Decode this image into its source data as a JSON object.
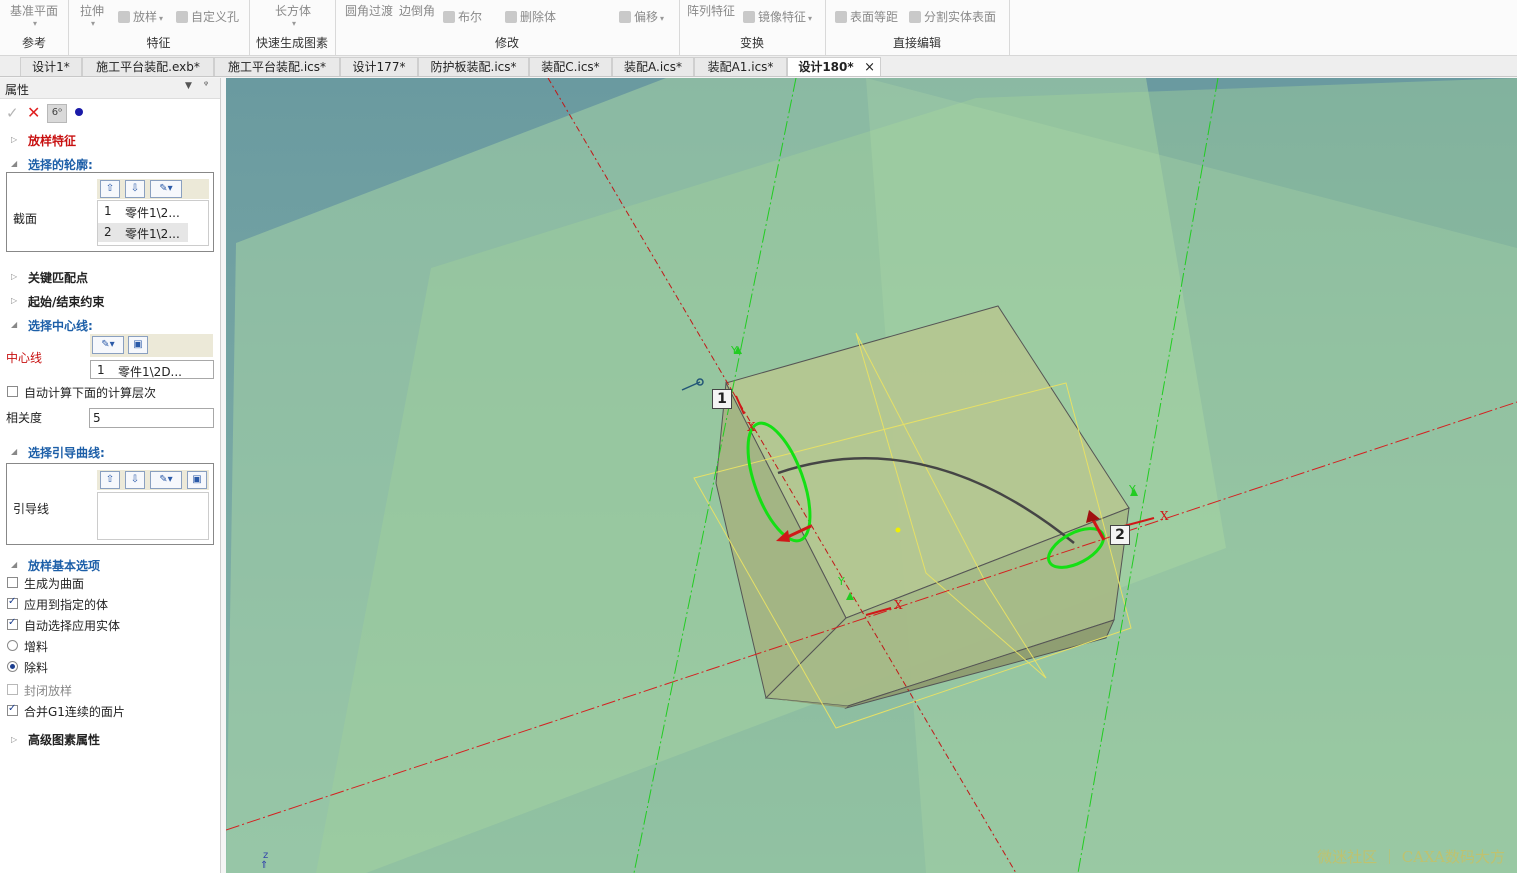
{
  "ribbon": {
    "groups": [
      {
        "label": "参考",
        "items": [
          "基准平面"
        ]
      },
      {
        "label": "特征",
        "items": [
          "拉伸",
          "放样",
          "自定义孔"
        ]
      },
      {
        "label": "快速生成图素",
        "items": [
          "长方体"
        ]
      },
      {
        "label": "修改",
        "items": [
          "圆角过渡",
          "边倒角",
          "布尔",
          "删除体",
          "偏移"
        ]
      },
      {
        "label": "变换",
        "items": [
          "阵列特征",
          "镜像特征"
        ]
      },
      {
        "label": "直接编辑",
        "items": [
          "表面等距",
          "分割实体表面"
        ]
      }
    ]
  },
  "tabs": [
    {
      "label": "设计1*"
    },
    {
      "label": "施工平台装配.exb*"
    },
    {
      "label": "施工平台装配.ics*"
    },
    {
      "label": "设计177*"
    },
    {
      "label": "防护板装配.ics*"
    },
    {
      "label": "装配C.ics*"
    },
    {
      "label": "装配A.ics*"
    },
    {
      "label": "装配A1.ics*"
    },
    {
      "label": "设计180*",
      "close": "×"
    }
  ],
  "panel": {
    "title": "属性",
    "loft_feature": "放样特征",
    "selected_profiles": {
      "heading": "选择的轮廓:",
      "label": "截面",
      "rows": [
        {
          "index": "1",
          "value": "零件1\\2..."
        },
        {
          "index": "2",
          "value": "零件1\\2..."
        }
      ]
    },
    "key_match_points": "关键匹配点",
    "start_end_constraints": "起始/结束约束",
    "centerline": {
      "heading": "选择中心线:",
      "label": "中心线",
      "row": {
        "index": "1",
        "value": "零件1\\2D..."
      }
    },
    "auto_compute": {
      "label": "自动计算下面的计算层次",
      "checked": false
    },
    "correlation": {
      "label": "相关度",
      "value": "5"
    },
    "guide_curves": {
      "heading": "选择引导曲线:",
      "label": "引导线"
    },
    "basic_options": {
      "heading": "放样基本选项",
      "options": [
        {
          "type": "checkbox",
          "label": "生成为曲面",
          "checked": false
        },
        {
          "type": "checkbox",
          "label": "应用到指定的体",
          "checked": true
        },
        {
          "type": "checkbox",
          "label": "自动选择应用实体",
          "checked": true
        },
        {
          "type": "radio",
          "label": "增料",
          "checked": false
        },
        {
          "type": "radio",
          "label": "除料",
          "checked": true
        },
        {
          "type": "checkbox",
          "label": "封闭放样",
          "checked": false
        },
        {
          "type": "checkbox",
          "label": "合并G1连续的面片",
          "checked": true
        }
      ]
    },
    "advanced": "高级图素属性"
  },
  "viewport": {
    "markers": [
      "1",
      "2"
    ],
    "axis_x": "X",
    "axis_y": "Y",
    "axis_z": "z",
    "watermark": "微迷社区 ｜ CAXA数码大方"
  }
}
